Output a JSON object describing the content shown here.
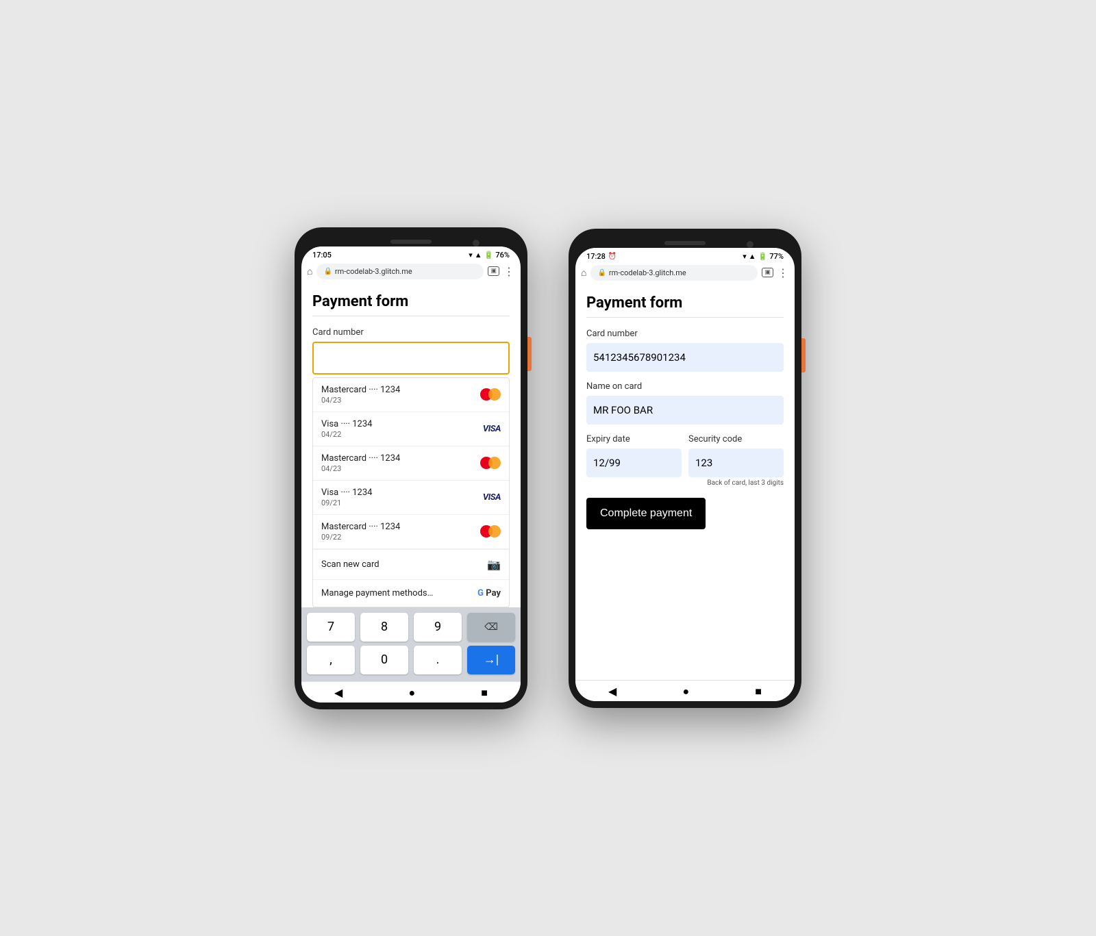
{
  "left_phone": {
    "status_time": "17:05",
    "status_battery": "76%",
    "url": "rm-codelab-3.glitch.me",
    "page_title": "Payment form",
    "field_label": "Card number",
    "card_input_placeholder": "",
    "autocomplete_items": [
      {
        "name": "Mastercard",
        "dots": "••••",
        "last4": "1234",
        "expiry": "04/23",
        "brand": "mastercard"
      },
      {
        "name": "Visa",
        "dots": "••••",
        "last4": "1234",
        "expiry": "04/22",
        "brand": "visa"
      },
      {
        "name": "Mastercard",
        "dots": "••••",
        "last4": "1234",
        "expiry": "04/23",
        "brand": "mastercard"
      },
      {
        "name": "Visa",
        "dots": "••••",
        "last4": "1234",
        "expiry": "09/21",
        "brand": "visa"
      },
      {
        "name": "Mastercard",
        "dots": "••••",
        "last4": "1234",
        "expiry": "09/22",
        "brand": "mastercard"
      }
    ],
    "scan_card_label": "Scan new card",
    "manage_payment_label": "Manage payment methods…",
    "keyboard": {
      "keys": [
        [
          "7",
          "8",
          "9",
          "⌫"
        ],
        [
          ",",
          "0",
          ".",
          ""
        ]
      ]
    },
    "nav_back": "◀",
    "nav_home": "●",
    "nav_recent": "■"
  },
  "right_phone": {
    "status_time": "17:28",
    "status_battery": "77%",
    "url": "rm-codelab-3.glitch.me",
    "page_title": "Payment form",
    "card_number_label": "Card number",
    "card_number_value": "5412345678901234",
    "name_on_card_label": "Name on card",
    "name_on_card_value": "MR FOO BAR",
    "expiry_date_label": "Expiry date",
    "expiry_date_value": "12/99",
    "security_code_label": "Security code",
    "security_code_value": "123",
    "security_hint": "Back of card, last 3 digits",
    "complete_button_label": "Complete payment",
    "nav_back": "◀",
    "nav_home": "●",
    "nav_recent": "■"
  },
  "colors": {
    "accent_orange": "#f0a000",
    "visa_blue": "#1a1f71",
    "input_bg": "#e8f0fe",
    "complete_btn_bg": "#000000"
  }
}
